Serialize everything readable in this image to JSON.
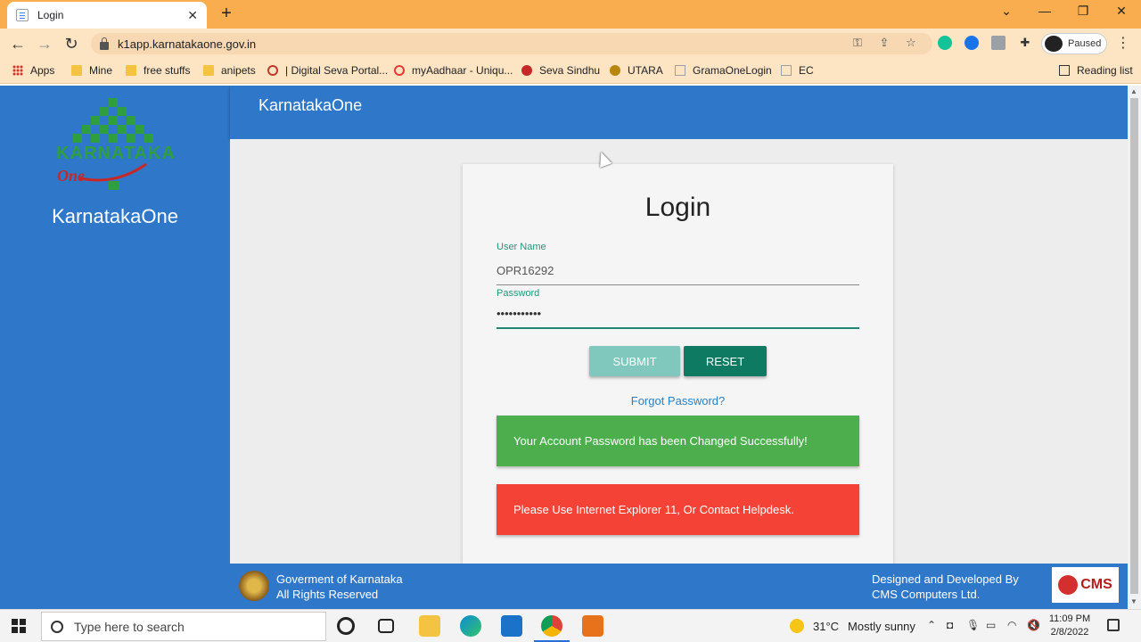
{
  "browser": {
    "tab_title": "Login",
    "url": "k1app.karnatakaone.gov.in",
    "profile_status": "Paused",
    "bookmarks": [
      "Apps",
      "Mine",
      "free stuffs",
      "anipets",
      "| Digital Seva Portal...",
      "myAadhaar - Uniqu...",
      "Seva Sindhu",
      "UTARA",
      "GramaOneLogin",
      "EC"
    ],
    "reading_list": "Reading list"
  },
  "sidebar": {
    "logo_text": "KARNATAKA",
    "logo_sub": "One",
    "title": "KarnatakaOne"
  },
  "header": {
    "title": "KarnatakaOne"
  },
  "login": {
    "title": "Login",
    "username_label": "User Name",
    "username_value": "OPR16292",
    "password_label": "Password",
    "password_value": "•••••••••••",
    "submit_label": "SUBMIT",
    "reset_label": "RESET",
    "forgot_label": "Forgot Password?",
    "success_message": "Your Account Password has been Changed Successfully!",
    "error_message": "Please Use Internet Explorer 11, Or Contact Helpdesk."
  },
  "footer": {
    "left_line1": "Goverment of Karnataka",
    "left_line2": "All Rights Reserved",
    "right_line1": "Designed and Developed By",
    "right_line2": "CMS Computers Ltd.",
    "cms_logo": "CMS"
  },
  "taskbar": {
    "search_placeholder": "Type here to search",
    "temperature": "31°C",
    "weather": "Mostly sunny",
    "time": "11:09 PM",
    "date": "2/8/2022"
  },
  "colors": {
    "brand_blue": "#2f78c9",
    "accent_teal": "#0f7a62",
    "success": "#4cae4c",
    "danger": "#f44336",
    "chrome_orange": "#f9ad4e"
  }
}
